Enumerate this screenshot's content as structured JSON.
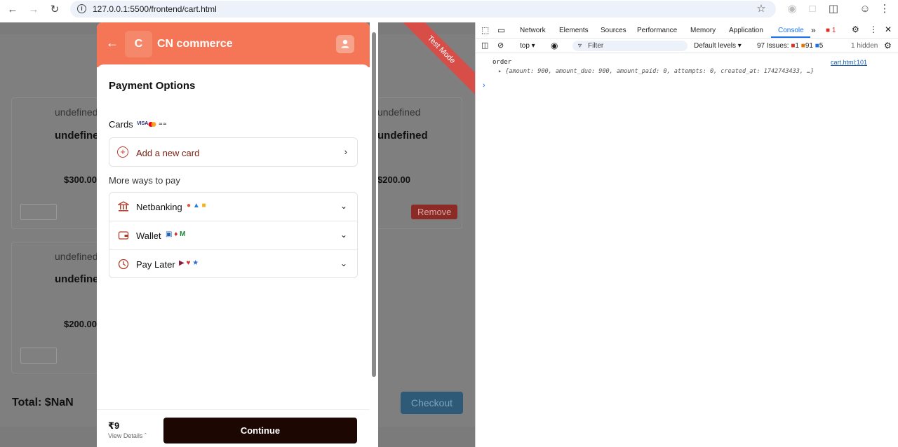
{
  "browser": {
    "url": "127.0.0.1:5500/frontend/cart.html"
  },
  "cart_page": {
    "items": [
      {
        "img_alt": "undefined",
        "title": "undefined",
        "price": "$300.00"
      },
      {
        "img_alt": "undefined",
        "title": "undefined",
        "price": "$200.00",
        "remove_label": "Remove"
      },
      {
        "img_alt": "undefined",
        "title": "undefined",
        "price": "$200.00"
      }
    ],
    "total": "Total: $NaN",
    "checkout_label": "Checkout"
  },
  "modal": {
    "logo_letter": "C",
    "merchant_name": "CN commerce",
    "title": "Payment Options",
    "cards_label": "Cards",
    "card_logos": [
      "VISA",
      "MC",
      "RuPay"
    ],
    "add_card_label": "Add a new card",
    "more_ways_label": "More ways to pay",
    "methods": [
      {
        "label": "Netbanking"
      },
      {
        "label": "Wallet"
      },
      {
        "label": "Pay Later"
      }
    ],
    "amount": "₹9",
    "view_details": "View Details",
    "continue_label": "Continue",
    "ribbon": "Test Mode"
  },
  "devtools": {
    "tabs": [
      "Network",
      "Elements",
      "Sources",
      "Performance",
      "Memory",
      "Application",
      "Console"
    ],
    "active_tab": "Console",
    "error_count": "1",
    "context": "top",
    "filter_placeholder": "Filter",
    "levels": "Default levels",
    "issues_label": "97 Issues:",
    "issues_red": "1",
    "issues_orange": "91",
    "issues_blue": "5",
    "hidden": "1 hidden",
    "console_label": "order",
    "console_object": "{amount: 900, amount_due: 900, amount_paid: 0, attempts: 0, created_at: 1742743433, …}",
    "console_source": "cart.html:101"
  },
  "colors": {
    "brand": "#f47656",
    "continue": "#1c0703",
    "ribbon": "#d74d47",
    "devtools_active": "#1a73e8"
  }
}
